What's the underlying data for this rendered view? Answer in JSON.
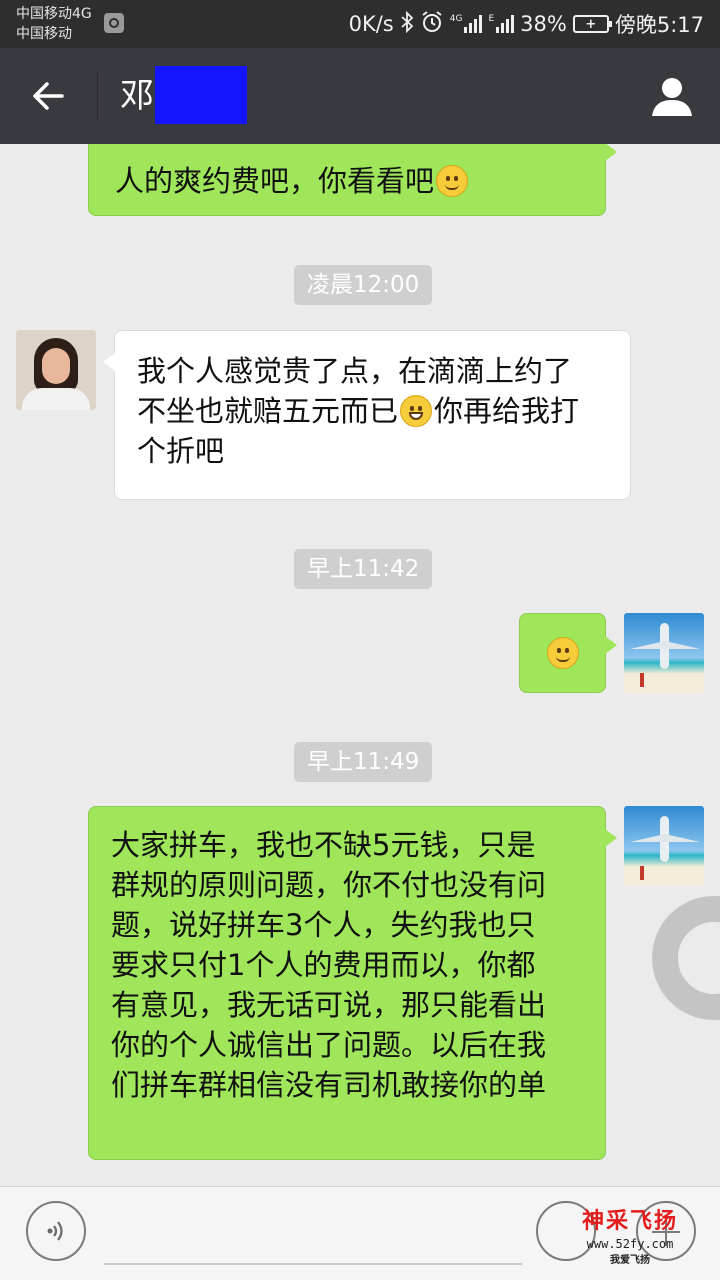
{
  "status_bar": {
    "carrier_1": "中国移动4G",
    "carrier_2": "中国移动",
    "net_speed": "0K/s",
    "battery": "38%",
    "time": "傍晚5:17"
  },
  "header": {
    "title": "邓"
  },
  "messages": [
    {
      "side": "right",
      "text": "人的爽约费吧，你看看吧"
    },
    {
      "timestamp": "凌晨12:00"
    },
    {
      "side": "left",
      "text_1": "我个人感觉贵了点，在滴滴上约了\n不坐也就赔五元而已",
      "text_2": "你再给我打\n个折吧"
    },
    {
      "timestamp": "早上11:42"
    },
    {
      "side": "right",
      "emoji": "smirk-emoji"
    },
    {
      "timestamp": "早上11:49"
    },
    {
      "side": "right",
      "text": "大家拼车，我也不缺5元钱，只是\n群规的原则问题，你不付也没有问\n题，说好拼车3个人，失约我也只\n要求只付1个人的费用而以，你都\n有意见，我无话可说，那只能看出\n你的个人诚信出了问题。以后在我\n们拼车群相信没有司机敢接你的单"
    }
  ],
  "watermark": {
    "brand": "神采飞扬",
    "url": "www.52fy.com",
    "slogan": "我爱飞扬"
  },
  "colors": {
    "header_bg": "#393a3f",
    "chat_bg": "#ebebeb",
    "sent_bubble": "#9fe65a",
    "received_bubble": "#ffffff"
  }
}
